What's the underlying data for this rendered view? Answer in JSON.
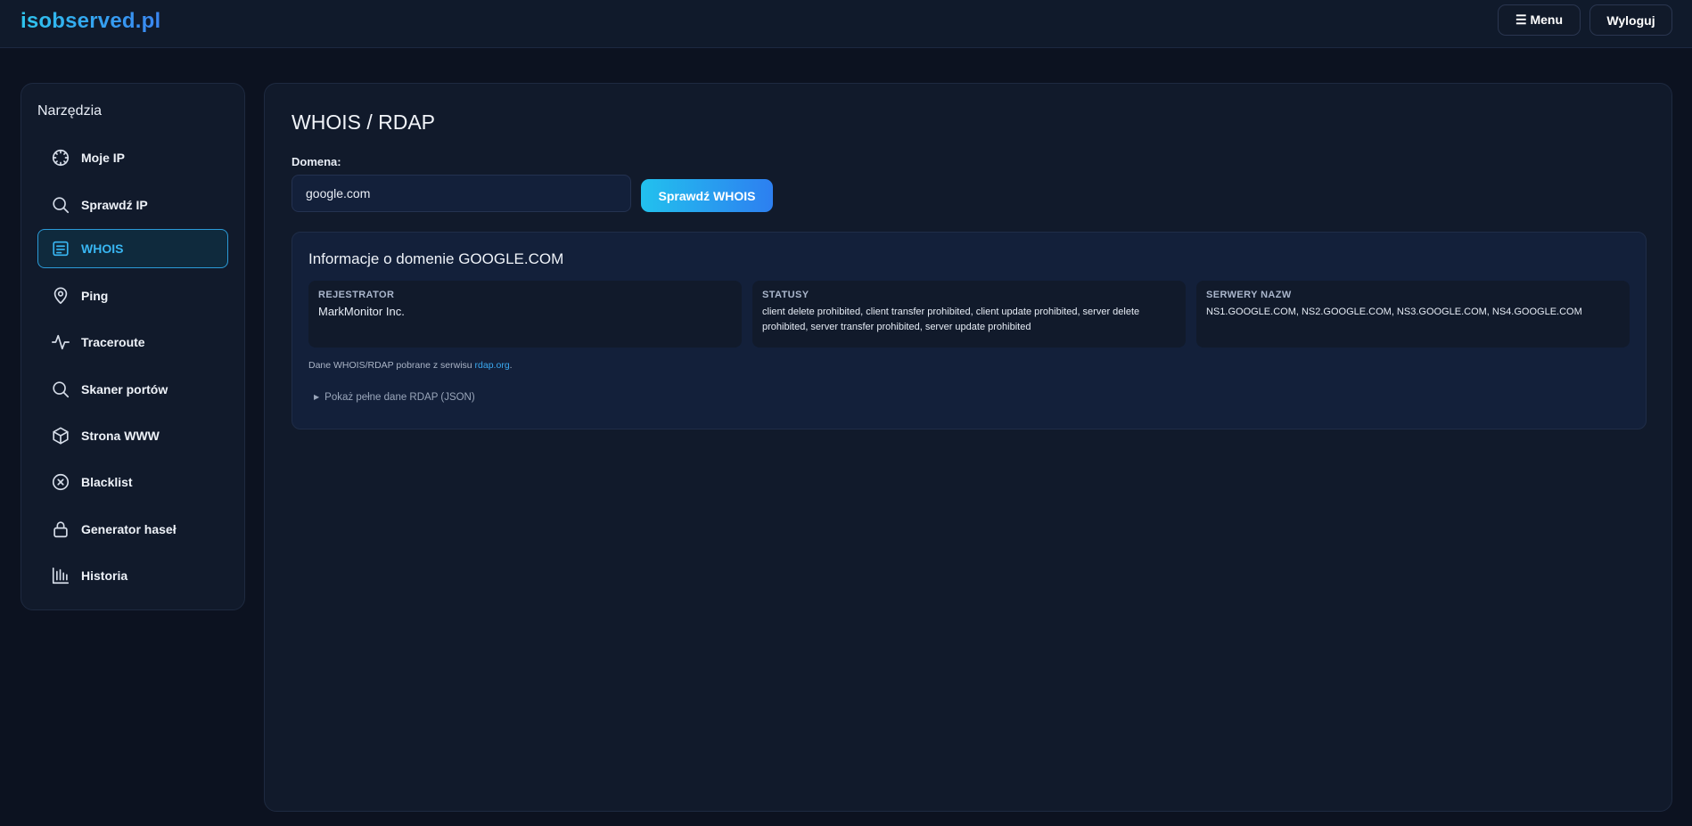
{
  "app": {
    "logo": "isobserved.pl"
  },
  "header": {
    "menu_icon": "hamburger-icon",
    "menu_label": "☰ Menu",
    "logout_label": "Wyloguj"
  },
  "sidebar": {
    "title": "Narzędzia",
    "items": [
      {
        "label": "Moje IP",
        "icon": "dial-icon",
        "active": false
      },
      {
        "label": "Sprawdź IP",
        "icon": "search-icon",
        "active": false
      },
      {
        "label": "WHOIS",
        "icon": "document-icon",
        "active": true
      },
      {
        "label": "Ping",
        "icon": "map-pin-icon",
        "active": false
      },
      {
        "label": "Traceroute",
        "icon": "activity-icon",
        "active": false
      },
      {
        "label": "Skaner portów",
        "icon": "search-icon",
        "active": false
      },
      {
        "label": "Strona WWW",
        "icon": "cube-icon",
        "active": false
      },
      {
        "label": "Blacklist",
        "icon": "x-circle-icon",
        "active": false
      },
      {
        "label": "Generator haseł",
        "icon": "lock-icon",
        "active": false
      },
      {
        "label": "Historia",
        "icon": "bar-chart-icon",
        "active": false
      }
    ]
  },
  "main": {
    "title": "WHOIS / RDAP",
    "domain_label": "Domena:",
    "domain_value": "google.com",
    "check_button": "Sprawdź WHOIS",
    "result": {
      "title": "Informacje o domenie GOOGLE.COM",
      "registrar_label": "REJESTRATOR",
      "registrar_value": "MarkMonitor Inc.",
      "status_label": "STATUSY",
      "status_value": "client delete prohibited, client transfer prohibited, client update prohibited, server delete prohibited, server transfer prohibited, server update prohibited",
      "nameservers_label": "SERWERY NAZW",
      "nameservers_value": "NS1.GOOGLE.COM, NS2.GOOGLE.COM, NS3.GOOGLE.COM, NS4.GOOGLE.COM",
      "source_prefix": "Dane WHOIS/RDAP pobrane z serwisu ",
      "source_link": "rdap.org",
      "source_suffix": ".",
      "json_toggle": "Pokaż pełne dane RDAP (JSON)"
    }
  },
  "colors": {
    "background": "#0c1220",
    "panel": "#111a2b",
    "accent": "#38b6f2",
    "button_gradient_start": "#22c1ee",
    "button_gradient_end": "#2d7ff0"
  }
}
